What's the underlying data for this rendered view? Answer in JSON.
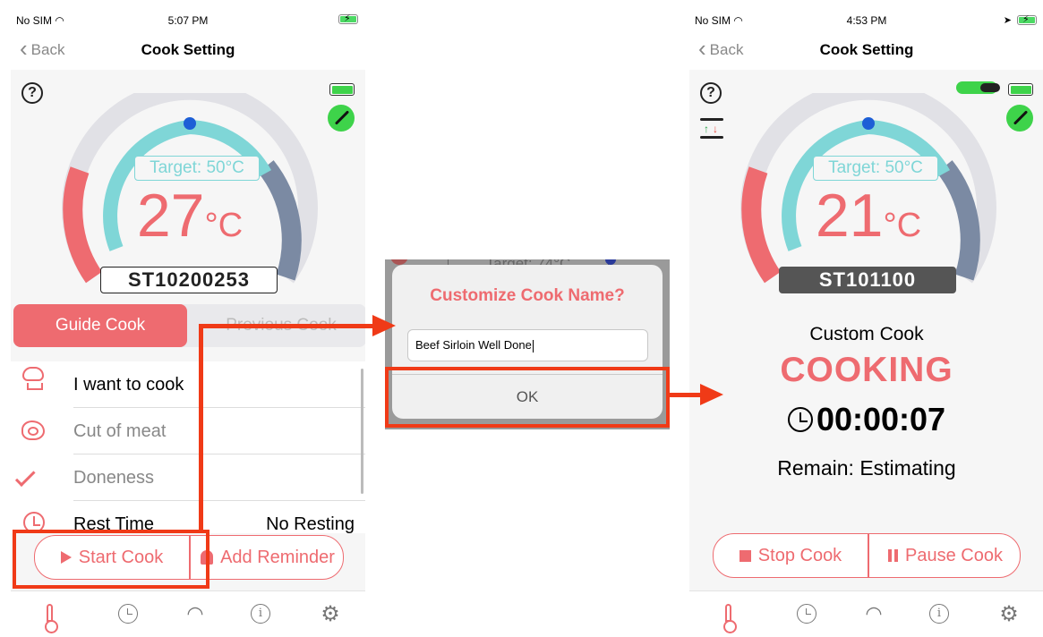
{
  "left_screen": {
    "status": {
      "carrier": "No SIM",
      "time": "5:07 PM"
    },
    "nav": {
      "back_label": "Back",
      "title": "Cook Setting"
    },
    "gauge": {
      "target_label": "Target: 50°C",
      "temp_value": "27",
      "temp_unit": "°C"
    },
    "device_id": "ST10200253",
    "segments": {
      "active": "Guide Cook",
      "inactive": "Previous Cook"
    },
    "list": [
      {
        "icon": "chef-hat-icon",
        "label": "I want to cook",
        "value": "",
        "dim": false
      },
      {
        "icon": "steak-icon",
        "label": "Cut of meat",
        "value": "",
        "dim": true
      },
      {
        "icon": "checkmark-icon",
        "label": "Doneness",
        "value": "",
        "dim": true
      },
      {
        "icon": "clock-icon",
        "label": "Rest Time",
        "value": "No Resting",
        "dim": false
      }
    ],
    "actions": {
      "start": "Start Cook",
      "reminder": "Add Reminder"
    }
  },
  "dialog": {
    "background_hint": "Target: 74°C",
    "title": "Customize Cook Name?",
    "input_value": "Beef Sirloin Well Done",
    "ok_label": "OK"
  },
  "right_screen": {
    "status": {
      "carrier": "No SIM",
      "time": "4:53 PM"
    },
    "nav": {
      "back_label": "Back",
      "title": "Cook Setting"
    },
    "gauge": {
      "target_label": "Target: 50°C",
      "temp_value": "21",
      "temp_unit": "°C"
    },
    "device_id": "ST101100",
    "cook_name": "Custom Cook",
    "state": "COOKING",
    "elapsed": "00:00:07",
    "remain": "Remain: Estimating",
    "actions": {
      "stop": "Stop Cook",
      "pause": "Pause Cook"
    }
  },
  "colors": {
    "accent": "#ee6b70",
    "cyan": "#7fd6d7",
    "slate": "#7b8aa3",
    "highlight": "#f03a17",
    "battery": "#3ed34a"
  }
}
